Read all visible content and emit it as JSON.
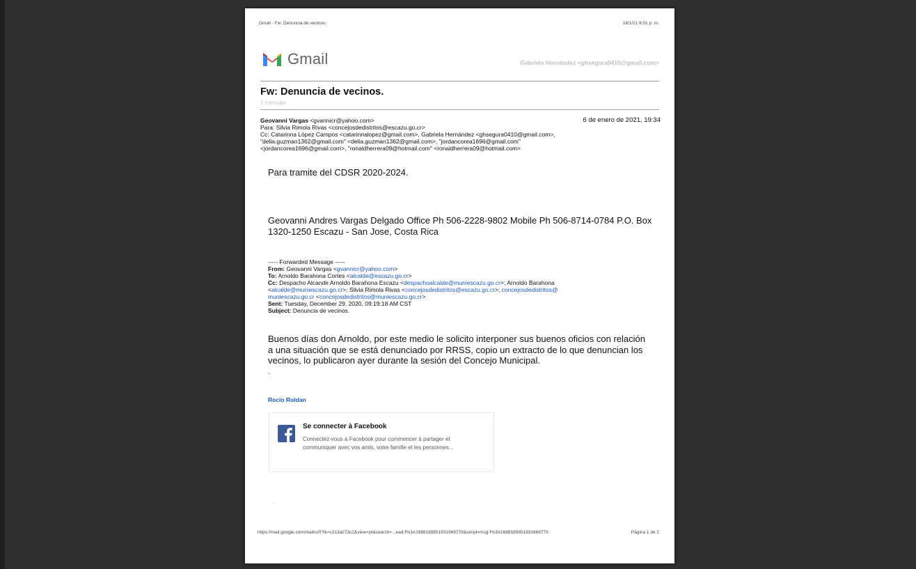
{
  "print_header": {
    "title": "Gmail - Fw: Denuncia de vecinos.",
    "timestamp": "18/1/21 8:01 p. m."
  },
  "logo": {
    "word": "Gmail"
  },
  "account": "Gabriela Hernández <ghsegura0410@gmail.com>",
  "thread": {
    "subject": "Fw: Denuncia de vecinos.",
    "count": "1 mensaje"
  },
  "message": {
    "sender_name": "Geovanni Vargas",
    "sender_email": " <gvannicr@yahoo.com>",
    "date": "6 de enero de 2021, 19:34",
    "to": "Para: Silvia Rimola Rivas <concejosdedistritos@escazu.go.cr>",
    "cc": [
      "Cc: Catarinna López Campos <catarinnalopez@gmail.com>, Gabriela Hernández <ghsegura0410@gmail.com>,",
      "\"delia.guzman1362@gmail.com\" <delia.guzman1362@gmail.com>, \"jordancorea1696@gmail.com\"",
      "<jordancorea1696@gmail.com>, \"ronaldherrera09@hotmail.com\" <ronaldherrera09@hotmail.com>"
    ],
    "body_line1": "Para tramite del CDSR 2020-2024.",
    "signature_lines": [
      "Geovanni Andres Vargas Delgado Office Ph 506-2228-9802 Mobile Ph 506-8714-0784 P.O. Box",
      "1320-1250 Escazu - San Jose, Costa Rica"
    ]
  },
  "forwarded": {
    "divider": "----- Forwarded Message -----",
    "from_label": "From:",
    "from_name": " Geovanni Vargas <",
    "from_link": "gvannicr@yahoo.com",
    "from_end": ">",
    "to_label": "To:",
    "to_name": " Arnoldo Barahona Cortes <",
    "to_link": "alcalde@escazu.go.cr",
    "to_end": ">",
    "cc_label": "Cc:",
    "cc_part1": " Despacho Alcande Arnoldo Barahona Escazu <",
    "cc_link1": "despachoalcalde@muniescazu.go.cr",
    "cc_part2": ">; Arnoldo Barahona",
    "cc_part3": "<",
    "cc_link2": "alcalde@muniescazu.go.cr",
    "cc_part4": ">; Silvia Rimola Rivas <",
    "cc_link3": "concejosdedistritos@escazu.go.cr",
    "cc_part5": ">; ",
    "cc_link4a": "concejosdedistritos@",
    "cc_link4b": "muniescazu.go.cr",
    "cc_part6": " <",
    "cc_link5": "concejosdedistritos@muniescazu.go.cr",
    "cc_part7": ">",
    "sent_label": "Sent:",
    "sent_value": " Tuesday, December 29, 2020, 09:19:18 AM CST",
    "subject_label": "Subject:",
    "subject_value": " Denuncia de vecinos.",
    "body_lines": [
      "Buenos días don Arnoldo, por este medio le solicito interponer sus buenos oficios con relación",
      "a una situación que se está denunciado por RRSS, copio un extracto de lo que denuncian los",
      "vecinos, lo publicaron ayer durante la sesión del Concejo Municipal."
    ],
    "quote_dot": "\"",
    "signature_name": "Rocio Roldan"
  },
  "facebook_card": {
    "title": "Se connecter à Facebook",
    "description": "Connectez-vous à Facebook pour commencer à partager et communiquer avec vos amis, votre famille et les personnes...",
    "icon": "facebook-icon"
  },
  "trailing_mark": ".",
  "print_footer": {
    "url": "https://mail.google.com/mail/u/0?ik=c313a273c2&view=pt&search=...ead-f%3A1688189851931669779&simpl=msg-f%3A1688189851931669779",
    "page": "Página 1 de 2"
  },
  "colors": {
    "link": "#1a57c9",
    "viewer_bg": "#303030",
    "facebook": "#3b5998"
  }
}
